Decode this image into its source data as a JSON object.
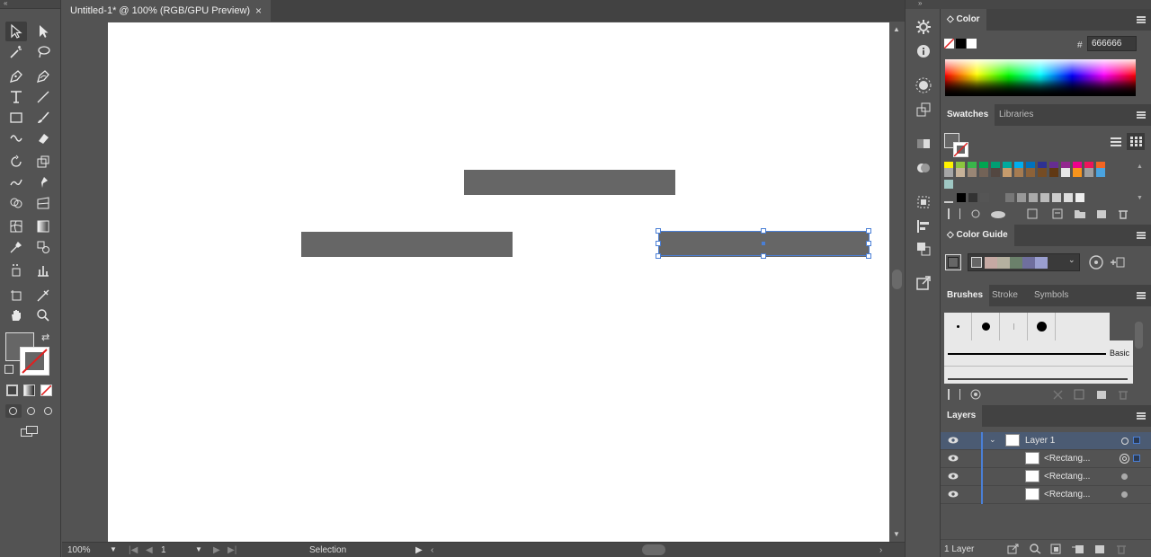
{
  "document": {
    "tab_title": "Untitled-1* @ 100% (RGB/GPU Preview)",
    "tab_close": "×"
  },
  "status": {
    "zoom": "100%",
    "page": "1",
    "mode": "Selection"
  },
  "panels": {
    "color": {
      "tab": "Color",
      "hex_label": "#",
      "hex_value": "666666"
    },
    "swatches": {
      "tabs": [
        "Swatches",
        "Libraries"
      ]
    },
    "color_guide": {
      "tab": "Color Guide"
    },
    "brushes": {
      "tabs": [
        "Brushes",
        "Stroke",
        "Symbols"
      ],
      "basic_label": "Basic"
    },
    "layers": {
      "tab": "Layers",
      "rows": [
        {
          "name": "Layer 1"
        },
        {
          "name": "<Rectang..."
        },
        {
          "name": "<Rectang..."
        },
        {
          "name": "<Rectang..."
        }
      ],
      "footer_count": "1 Layer"
    }
  },
  "colors": {
    "accent": "#4a7fd6",
    "fill": "#666666",
    "ui_bg": "#535353"
  },
  "icons": [
    "selection-tool-icon",
    "direct-selection-icon",
    "magic-wand-icon",
    "lasso-icon",
    "pen-icon",
    "type-icon",
    "line-icon",
    "rectangle-icon",
    "paintbrush-icon",
    "shaper-icon",
    "eraser-icon",
    "rotate-icon",
    "scale-icon",
    "warp-icon",
    "puppet-warp-icon",
    "shape-builder-icon",
    "perspective-icon",
    "mesh-icon",
    "gradient-icon",
    "eyedropper-icon",
    "blend-icon",
    "symbol-sprayer-icon",
    "graph-icon",
    "artboard-icon",
    "slice-icon",
    "hand-icon",
    "zoom-icon"
  ]
}
